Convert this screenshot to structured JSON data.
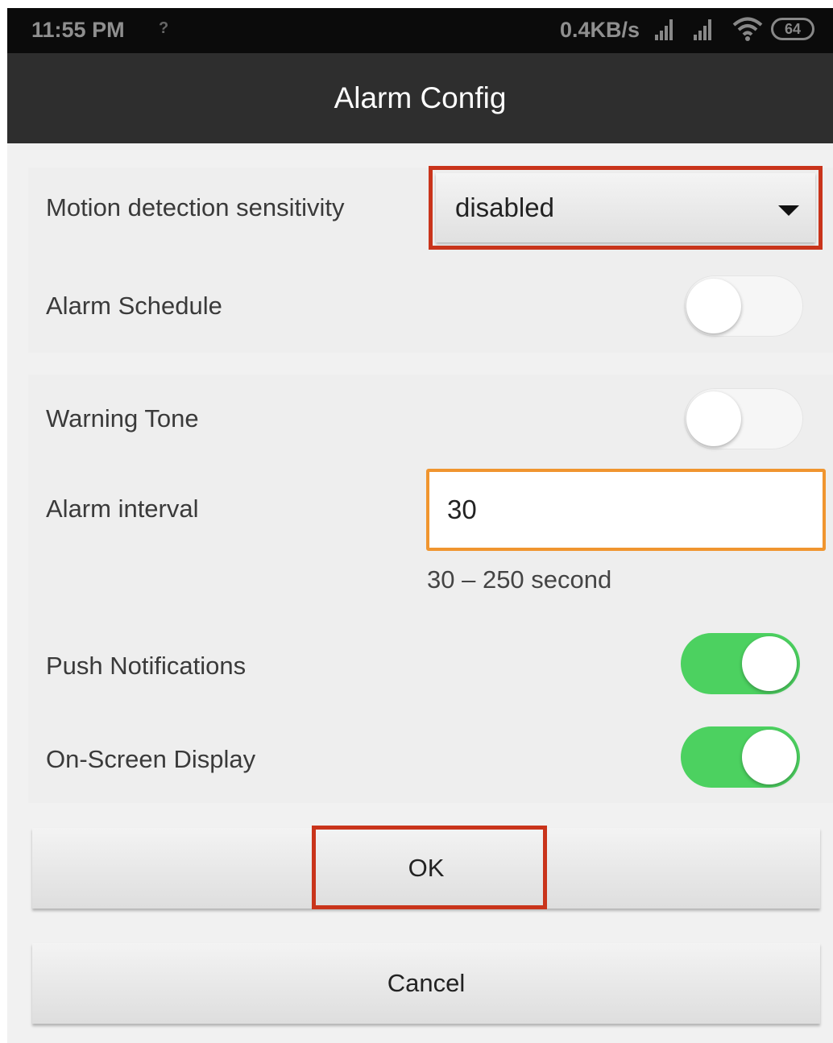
{
  "status_bar": {
    "time": "11:55 PM",
    "speed": "0.4KB/s",
    "battery": "64"
  },
  "title": "Alarm Config",
  "motion": {
    "label": "Motion detection sensitivity",
    "value": "disabled"
  },
  "alarm_schedule": {
    "label": "Alarm Schedule",
    "on": false
  },
  "warning_tone": {
    "label": "Warning Tone",
    "on": false
  },
  "alarm_interval": {
    "label": "Alarm interval",
    "value": "30",
    "hint": "30 – 250 second"
  },
  "push_notifications": {
    "label": "Push Notifications",
    "on": true
  },
  "on_screen_display": {
    "label": "On-Screen Display",
    "on": true
  },
  "buttons": {
    "ok": "OK",
    "cancel": "Cancel"
  },
  "colors": {
    "toggle_on": "#4cd160",
    "highlight_red": "#c9341b",
    "input_focus": "#f0952f",
    "title_bar": "#2e2e2e"
  }
}
